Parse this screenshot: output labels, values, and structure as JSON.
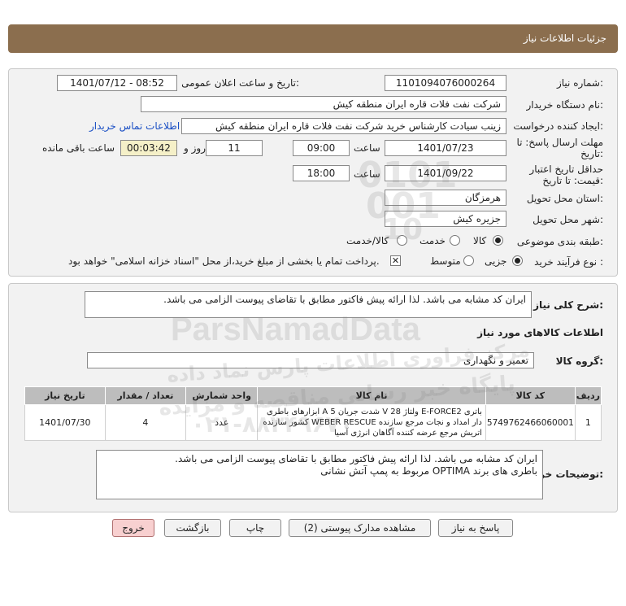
{
  "header": {
    "title": "جزئیات اطلاعات نیاز"
  },
  "form": {
    "need_number_label": "شماره نیاز:",
    "need_number": "1101094076000264",
    "announce_label": "تاریخ و ساعت اعلان عمومی:",
    "announce_value": "1401/07/12 - 08:52",
    "buyer_org_label": "نام دستگاه خریدار:",
    "buyer_org": "شرکت نفت فلات قاره ایران منطقه کیش",
    "creator_label": "ایجاد کننده درخواست:",
    "creator": "زینب سیادت کارشناس خرید  شرکت نفت فلات قاره ایران منطقه کیش",
    "contact_link": "اطلاعات تماس خریدار",
    "deadline_label_1": "مهلت ارسال پاسخ: تا",
    "deadline_label_2": "تاریخ:",
    "deadline_date": "1401/07/23",
    "time_label": "ساعت",
    "deadline_time": "09:00",
    "days_value": "11",
    "days_label": "روز و",
    "remaining_value": "00:03:42",
    "remaining_label": "ساعت باقی مانده",
    "validity_label_1": "حداقل تاریخ اعتبار",
    "validity_label_2": "قیمت: تا تاریخ:",
    "validity_date": "1401/09/22",
    "validity_time": "18:00",
    "province_label": "استان محل تحویل:",
    "province": "هرمزگان",
    "city_label": "شهر محل تحویل:",
    "city": "جزیره کیش",
    "category_label": "طبقه بندی موضوعی:",
    "category_options": [
      "کالا",
      "خدمت",
      "کالا/خدمت"
    ],
    "process_label": "نوع فرآیند خرید :",
    "process_options": [
      "جزیی",
      "متوسط"
    ],
    "payment_note": "پرداخت تمام یا بخشی از مبلغ خرید،از محل \"اسناد خزانه اسلامی\" خواهد بود."
  },
  "summary": {
    "label": "شرح کلی نیاز:",
    "text": "ایران کد مشابه می باشد. لذا ارائه پیش فاکتور مطابق با تقاضای پیوست الزامی می باشد.",
    "goods_info_title": "اطلاعات کالاهای مورد نیاز",
    "group_label": "گروه کالا:",
    "group_value": "تعمیر و نگهداری"
  },
  "table": {
    "headers": [
      "ردیف",
      "کد کالا",
      "نام کالا",
      "واحد شمارش",
      "تعداد / مقدار",
      "تاریخ نیاز"
    ],
    "rows": [
      {
        "index": "1",
        "code": "5749762466060001",
        "name_line1": "باتری E-FORCE2 ولتاژ V 28 شدت جریان A 5 ابزارهای باطری",
        "name_line2": "دار امداد و نجات مرجع سازنده WEBER RESCUE کشور سازنده",
        "name_line3": "اتریش مرجع عرضه کننده آگاهان انرژی آسیا",
        "unit": "عدد",
        "qty": "4",
        "date": "1401/07/30"
      }
    ]
  },
  "buyer_notes": {
    "label": "توضیحات خریدار:",
    "line1": "ایران کد مشابه می باشد. لذا ارائه پیش فاکتور مطابق با تقاضای پیوست الزامی می باشد.",
    "line2": "باطری های برند OPTIMA مربوط به پمپ آتش نشانی"
  },
  "buttons": {
    "reply": "پاسخ به نیاز",
    "docs": "مشاهده مدارک پیوستی (2)",
    "print": "چاپ",
    "back": "بازگشت",
    "exit": "خروج"
  },
  "watermark": {
    "brand": "ParsNamadData",
    "line1": "مرکز فراوری اطلاعات پارس نماد داده",
    "line2": "پایگاه خبر رسانی مناقصه و مزایده",
    "phone": "۰۲۱-۸۸۳۴۹۶۷۰",
    "digits1": "0101",
    "digits2": "001",
    "digits3": "10"
  },
  "colors": {
    "header": "#8B6E4E",
    "panel": "#F2F2F2",
    "table_header": "#BDBDBD",
    "link": "#1A4FC4",
    "exit_button": "#F8D0D0"
  }
}
